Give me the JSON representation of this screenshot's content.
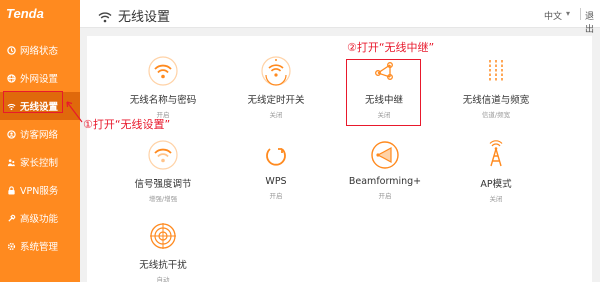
{
  "brand": {
    "logo": "Tenda",
    "accent": "#ff8a1f",
    "annotation_color": "#e8192c"
  },
  "header": {
    "title": "无线设置",
    "title_icon": "wifi-icon",
    "language": "中文",
    "logout": "退出"
  },
  "sidebar": {
    "items": [
      {
        "label": "网络状态",
        "icon": "status-icon",
        "active": false
      },
      {
        "label": "外网设置",
        "icon": "globe-icon",
        "active": false
      },
      {
        "label": "无线设置",
        "icon": "wifi-icon",
        "active": true
      },
      {
        "label": "访客网络",
        "icon": "guest-icon",
        "active": false
      },
      {
        "label": "家长控制",
        "icon": "parental-icon",
        "active": false
      },
      {
        "label": "VPN服务",
        "icon": "vpn-icon",
        "active": false
      },
      {
        "label": "高级功能",
        "icon": "advanced-icon",
        "active": false
      },
      {
        "label": "系统管理",
        "icon": "gear-icon",
        "active": false
      }
    ]
  },
  "tiles": [
    {
      "label": "无线名称与密码",
      "status": "开启",
      "icon": "wifi-icon"
    },
    {
      "label": "无线定时开关",
      "status": "关闭",
      "icon": "wifi-timer-icon"
    },
    {
      "label": "无线中继",
      "status": "关闭",
      "icon": "relay-icon"
    },
    {
      "label": "无线信道与频宽",
      "status": "信道/频宽",
      "icon": "channel-icon"
    },
    {
      "label": "信号强度调节",
      "status": "增强/增强",
      "icon": "signal-strength-icon"
    },
    {
      "label": "WPS",
      "status": "开启",
      "icon": "wps-icon"
    },
    {
      "label": "Beamforming+",
      "status": "开启",
      "icon": "beamforming-icon"
    },
    {
      "label": "AP模式",
      "status": "关闭",
      "icon": "ap-mode-icon"
    },
    {
      "label": "无线抗干扰",
      "status": "自动",
      "icon": "anti-interference-icon"
    }
  ],
  "annotations": {
    "step1": "①打开“无线设置”",
    "step2": "②打开“无线中继”"
  }
}
